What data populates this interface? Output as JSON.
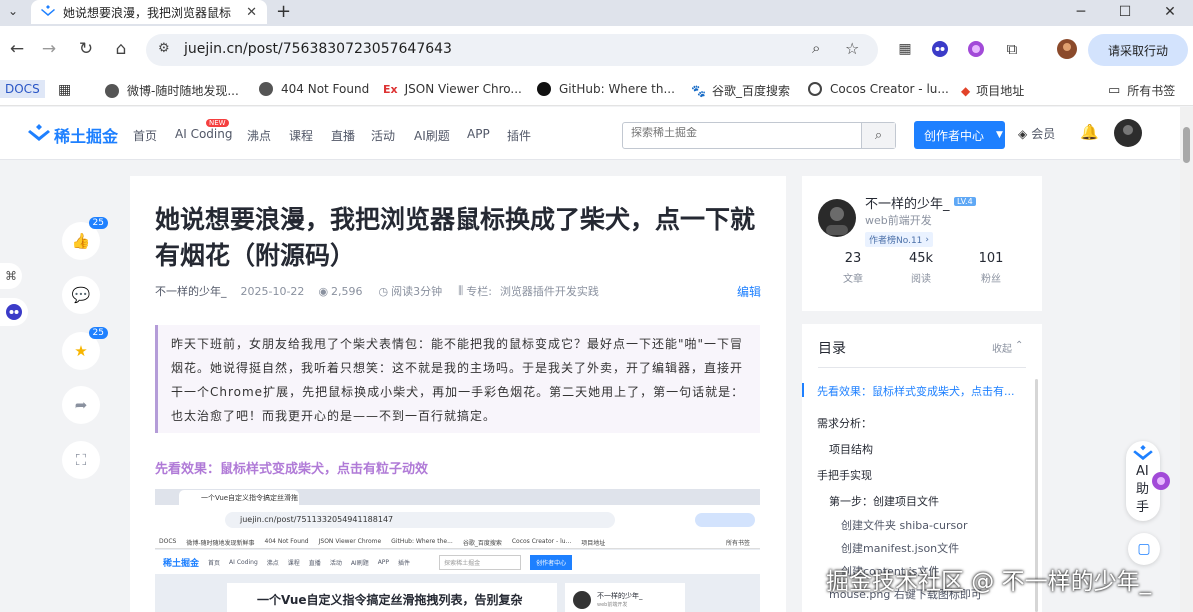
{
  "browser": {
    "tab_title": "她说想要浪漫，我把浏览器鼠标",
    "url": "juejin.cn/post/7563830723057647643",
    "profile_button": "请采取行动"
  },
  "bookmarks": [
    "DOCS",
    "微博-随时随地发现...",
    "404 Not Found",
    "JSON Viewer Chro...",
    "GitHub: Where th...",
    "谷歌_百度搜索",
    "Cocos Creator - lu...",
    "项目地址",
    "所有书签"
  ],
  "site": {
    "logo_text": "稀土掘金",
    "nav": [
      "首页",
      "AI Coding",
      "沸点",
      "课程",
      "直播",
      "活动",
      "AI刷题",
      "APP",
      "插件"
    ],
    "new_badge": "NEW",
    "search_placeholder": "探索稀土掘金",
    "creator_button": "创作者中心",
    "member": "会员"
  },
  "article": {
    "title": "她说想要浪漫，我把浏览器鼠标换成了柴犬，点一下就有烟花（附源码）",
    "author": "不一样的少年_",
    "date": "2025-10-22",
    "views": "2,596",
    "read_time": "阅读3分钟",
    "column_label": "专栏:",
    "column": "浏览器插件开发实践",
    "edit": "编辑",
    "quote": "昨天下班前，女朋友给我甩了个柴犬表情包：能不能把我的鼠标变成它？最好点一下还能\"啪\"一下冒烟花。她说得挺自然，我听着只想笑：这不就是我的主场吗。于是我关了外卖，开了编辑器，直接开干一个Chrome扩展，先把鼠标换成小柴犬，再加一手彩色烟花。第二天她用上了，第一句话就是：也太治愈了吧！而我更开心的是——不到一百行就搞定。",
    "section_heading": "先看效果：鼠标样式变成柴犬，点击有粒子动效",
    "screenshot": {
      "tab": "一个Vue自定义指令搞定丝滑拖",
      "url": "juejin.cn/post/7511332054941188147",
      "bookmarks": [
        "DOCS",
        "微博-随时随地发现新鲜事",
        "404 Not Found",
        "JSON Viewer Chrome",
        "GitHub: Where the...",
        "谷歌_百度搜索",
        "Cocos Creator - lu...",
        "项目地址",
        "所有书签"
      ],
      "logo": "稀土掘金",
      "nav": [
        "首页",
        "AI Coding",
        "沸点",
        "课程",
        "直播",
        "活动",
        "AI刷题",
        "APP",
        "插件"
      ],
      "search": "探索稀土掘金",
      "creator": "创作者中心",
      "title": "一个Vue自定义指令搞定丝滑拖拽列表，告别复杂",
      "author": "不一样的少年_",
      "author_sub": "web前端开发"
    }
  },
  "side_actions": {
    "like_count": "25",
    "star_count": "25"
  },
  "author_card": {
    "name": "不一样的少年_",
    "level": "LV.4",
    "title": "web前端开发",
    "rank": "作者榜No.11",
    "stats": [
      {
        "value": "23",
        "label": "文章"
      },
      {
        "value": "45k",
        "label": "阅读"
      },
      {
        "value": "101",
        "label": "粉丝"
      }
    ]
  },
  "toc": {
    "title": "目录",
    "collapse": "收起",
    "items": [
      {
        "text": "先看效果：鼠标样式变成柴犬，点击有...",
        "level": 1,
        "active": true
      },
      {
        "text": "需求分析：",
        "level": 1,
        "active": false
      },
      {
        "text": "项目结构",
        "level": 2,
        "active": false
      },
      {
        "text": "手把手实现",
        "level": 1,
        "active": false
      },
      {
        "text": "第一步：创建项目文件",
        "level": 2,
        "active": false
      },
      {
        "text": "创建文件夹 shiba-cursor",
        "level": 3,
        "active": false
      },
      {
        "text": "创建manifest.json文件",
        "level": 3,
        "active": false
      },
      {
        "text": "创建content.js文件",
        "level": 3,
        "active": false
      },
      {
        "text": "mouse.png 右键下载图标即可",
        "level": 3,
        "active": false
      }
    ]
  },
  "ai_assistant": "AI助手",
  "watermark": "掘金技术社区 @ 不一样的少年_",
  "colors": {
    "brand": "#1e80ff",
    "accent_purple": "#b07ad7",
    "profile": "#d3e3fd"
  }
}
